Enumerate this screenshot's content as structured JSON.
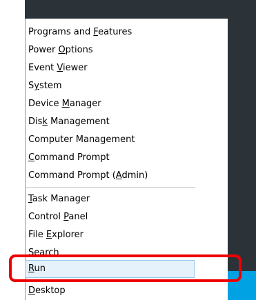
{
  "menu": {
    "group1": [
      {
        "pre": "Programs and ",
        "mn": "F",
        "post": "eatures"
      },
      {
        "pre": "Power ",
        "mn": "O",
        "post": "ptions"
      },
      {
        "pre": "Event ",
        "mn": "V",
        "post": "iewer"
      },
      {
        "pre": "S",
        "mn": "y",
        "post": "stem"
      },
      {
        "pre": "Device ",
        "mn": "M",
        "post": "anager"
      },
      {
        "pre": "Dis",
        "mn": "k",
        "post": " Management"
      },
      {
        "pre": "Computer Mana",
        "mn": "g",
        "post": "ement"
      },
      {
        "pre": "",
        "mn": "C",
        "post": "ommand Prompt"
      },
      {
        "pre": "Command Prompt (",
        "mn": "A",
        "post": "dmin)"
      }
    ],
    "group2": [
      {
        "pre": "",
        "mn": "T",
        "post": "ask Manager"
      },
      {
        "pre": "Control ",
        "mn": "P",
        "post": "anel"
      },
      {
        "pre": "File ",
        "mn": "E",
        "post": "xplorer"
      },
      {
        "pre": "",
        "mn": "S",
        "post": "earch"
      },
      {
        "pre": "",
        "mn": "R",
        "post": "un"
      },
      {
        "pre": "",
        "mn": "D",
        "post": "esktop"
      }
    ]
  },
  "colors": {
    "desktop_bg": "#2b3339",
    "accent_strip": "#00a2e3",
    "highlight": "#e5f1fb",
    "callout": "#ee0000"
  }
}
